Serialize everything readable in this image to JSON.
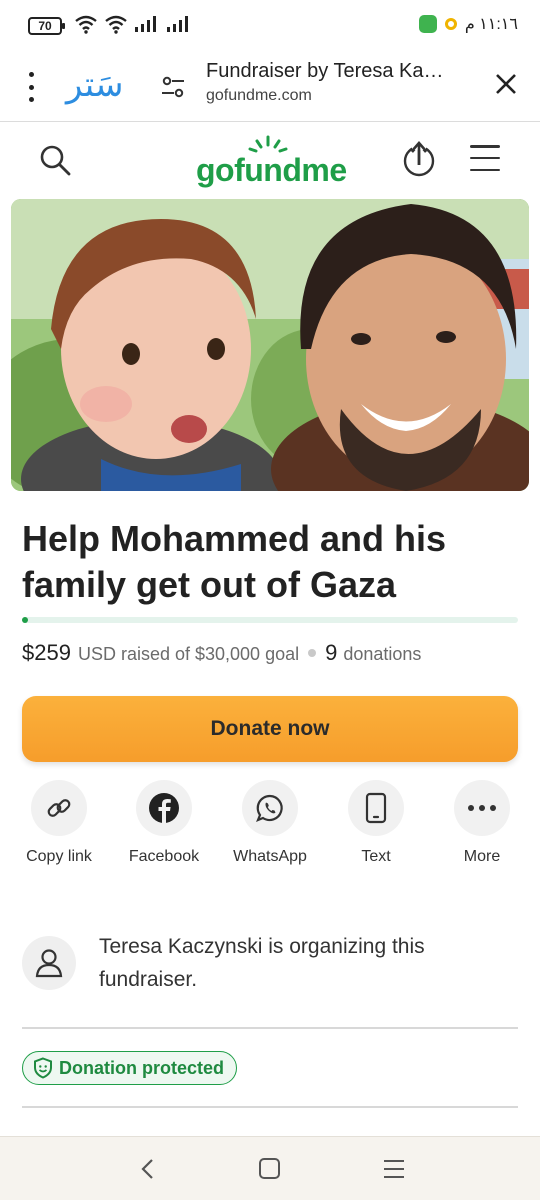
{
  "status_bar": {
    "battery": "70",
    "time": "١١:١٦ م"
  },
  "browser": {
    "app_logo": "سَتر",
    "page_title": "Fundraiser by Teresa Ka…",
    "domain": "gofundme.com"
  },
  "site": {
    "logo_text": "gofundme",
    "brand_color": "#1f9e48"
  },
  "campaign": {
    "title": "Help Mohammed and his family get out of Gaza",
    "amount_raised": "$259",
    "raised_text": "USD raised of $30,000 goal",
    "donation_count": "9",
    "donations_label": "donations",
    "progress_fraction": 0.0086,
    "donate_label": "Donate now"
  },
  "share": {
    "items": [
      {
        "label": "Copy link",
        "icon": "link-icon"
      },
      {
        "label": "Facebook",
        "icon": "facebook-icon"
      },
      {
        "label": "WhatsApp",
        "icon": "whatsapp-icon"
      },
      {
        "label": "Text",
        "icon": "phone-icon"
      },
      {
        "label": "More",
        "icon": "more-icon"
      }
    ]
  },
  "organizer": {
    "text": "Teresa Kaczynski is organizing this fundraiser."
  },
  "badge": {
    "label": "Donation protected"
  },
  "colors": {
    "accent_orange": "#f9a834",
    "progress_track": "#e4f3ec"
  }
}
